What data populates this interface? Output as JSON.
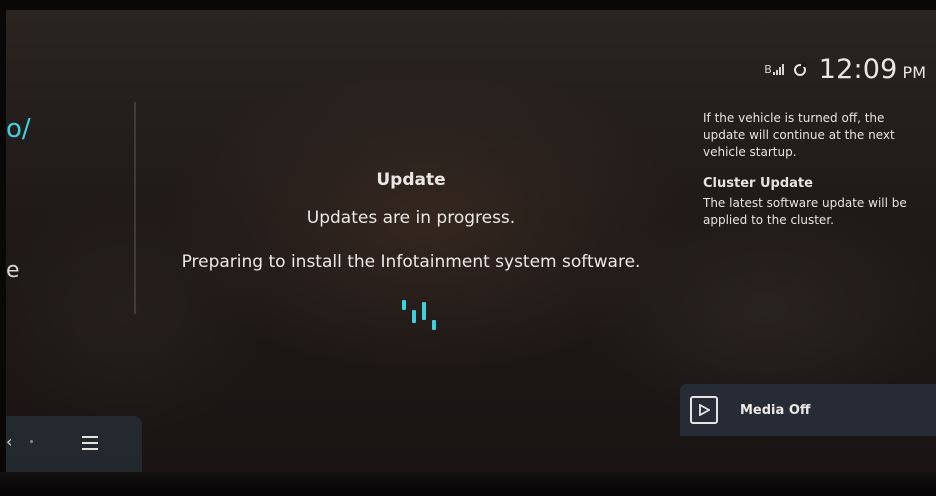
{
  "status_bar": {
    "bluetooth_icon": "bluetooth-icon",
    "bluetooth_glyph": "B",
    "signal_icon": "signal-icon",
    "sync_icon": "sync-icon",
    "time": "12:09",
    "ampm": "PM"
  },
  "left_panel": {
    "partial_label_1": "o/",
    "partial_label_2": "e",
    "back_glyph": "‹",
    "menu_icon": "menu-icon"
  },
  "update": {
    "title": "Update",
    "status": "Updates are in progress.",
    "detail": "Preparing to install the Infotainment system software.",
    "spinner_icon": "loading-spinner-icon",
    "accent_color": "#3fd0e0"
  },
  "info_panel": {
    "notice": "If the vehicle is turned off, the update will continue at the next vehicle startup.",
    "cluster_heading": "Cluster Update",
    "cluster_text": "The latest software update will be applied to the cluster."
  },
  "media": {
    "icon": "play-icon",
    "label": "Media Off"
  }
}
